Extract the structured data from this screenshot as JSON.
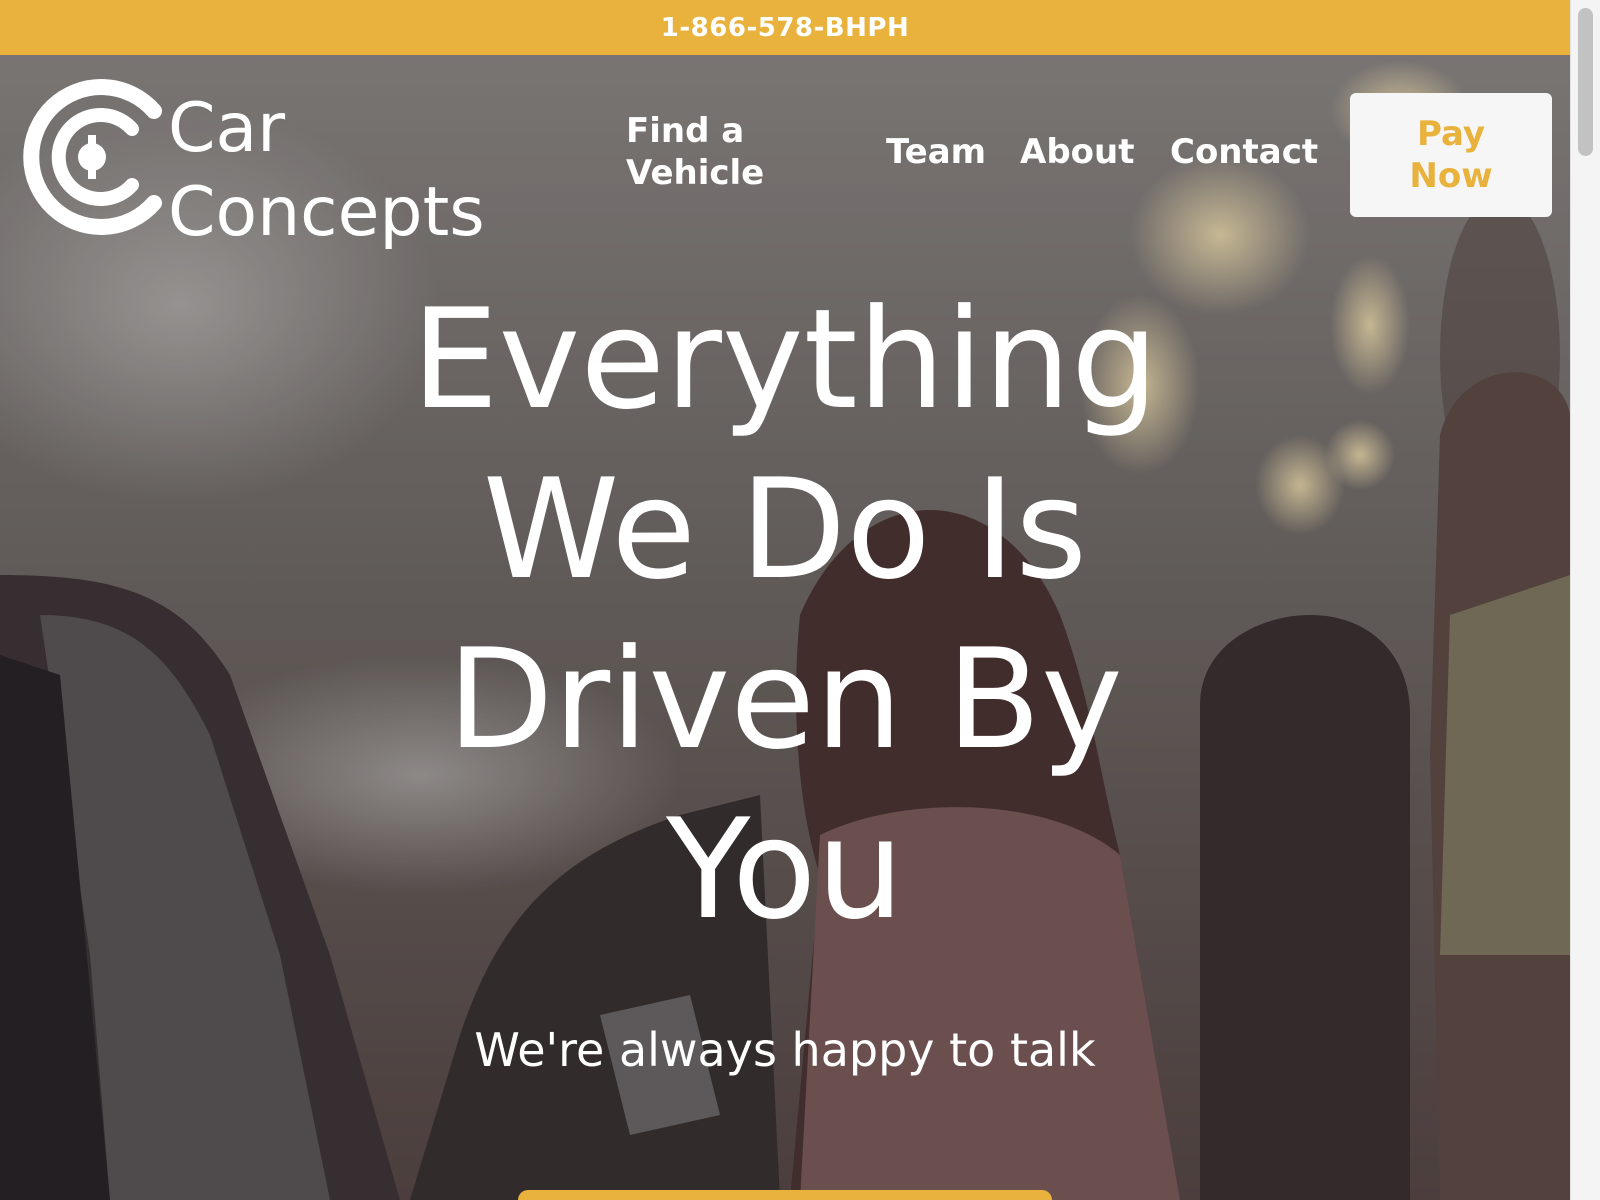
{
  "top_bar": {
    "phone": "1-866-578-BHPH"
  },
  "header": {
    "logo": {
      "line1": "Car",
      "line2": "Concepts",
      "icon": "car-concepts-logo-icon"
    },
    "nav": {
      "find_vehicle": "Find a Vehicle",
      "team": "Team",
      "about": "About",
      "contact": "Contact"
    },
    "pay_now": "Pay Now"
  },
  "hero": {
    "headline": "Everything We Do Is Driven By You",
    "subheadline": "We're always happy to talk",
    "background": "photo-woman-entering-car-on-street"
  },
  "colors": {
    "accent": "#e8b23d",
    "button_bg": "#f6f6f6",
    "text": "#ffffff"
  }
}
